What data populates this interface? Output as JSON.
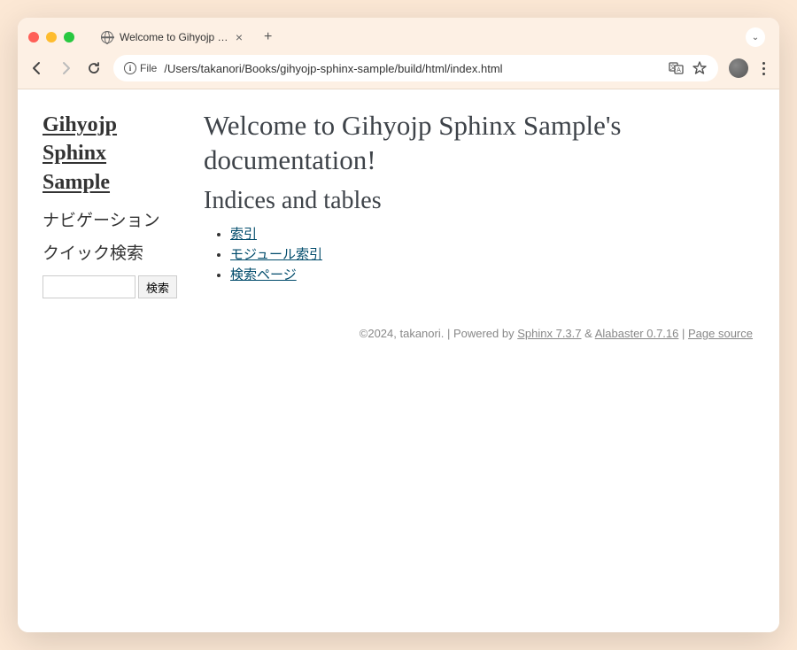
{
  "browser": {
    "tab_title": "Welcome to Gihyojp Sphinx S",
    "file_label": "File",
    "url": "/Users/takanori/Books/gihyojp-sphinx-sample/build/html/index.html"
  },
  "sidebar": {
    "title": "Gihyojp Sphinx Sample",
    "nav_heading": "ナビゲーション",
    "search_heading": "クイック検索",
    "search_button": "検索"
  },
  "main": {
    "h1": "Welcome to Gihyojp Sphinx Sample's documentation!",
    "h2": "Indices and tables",
    "links": {
      "genindex": "索引",
      "modindex": "モジュール索引",
      "search": "検索ページ"
    }
  },
  "footer": {
    "copyright": "©2024, takanori.",
    "powered_by_prefix": " | Powered by ",
    "sphinx": "Sphinx 7.3.7",
    "amp": " & ",
    "alabaster": "Alabaster 0.7.16",
    "sep": " | ",
    "page_source": "Page source"
  }
}
